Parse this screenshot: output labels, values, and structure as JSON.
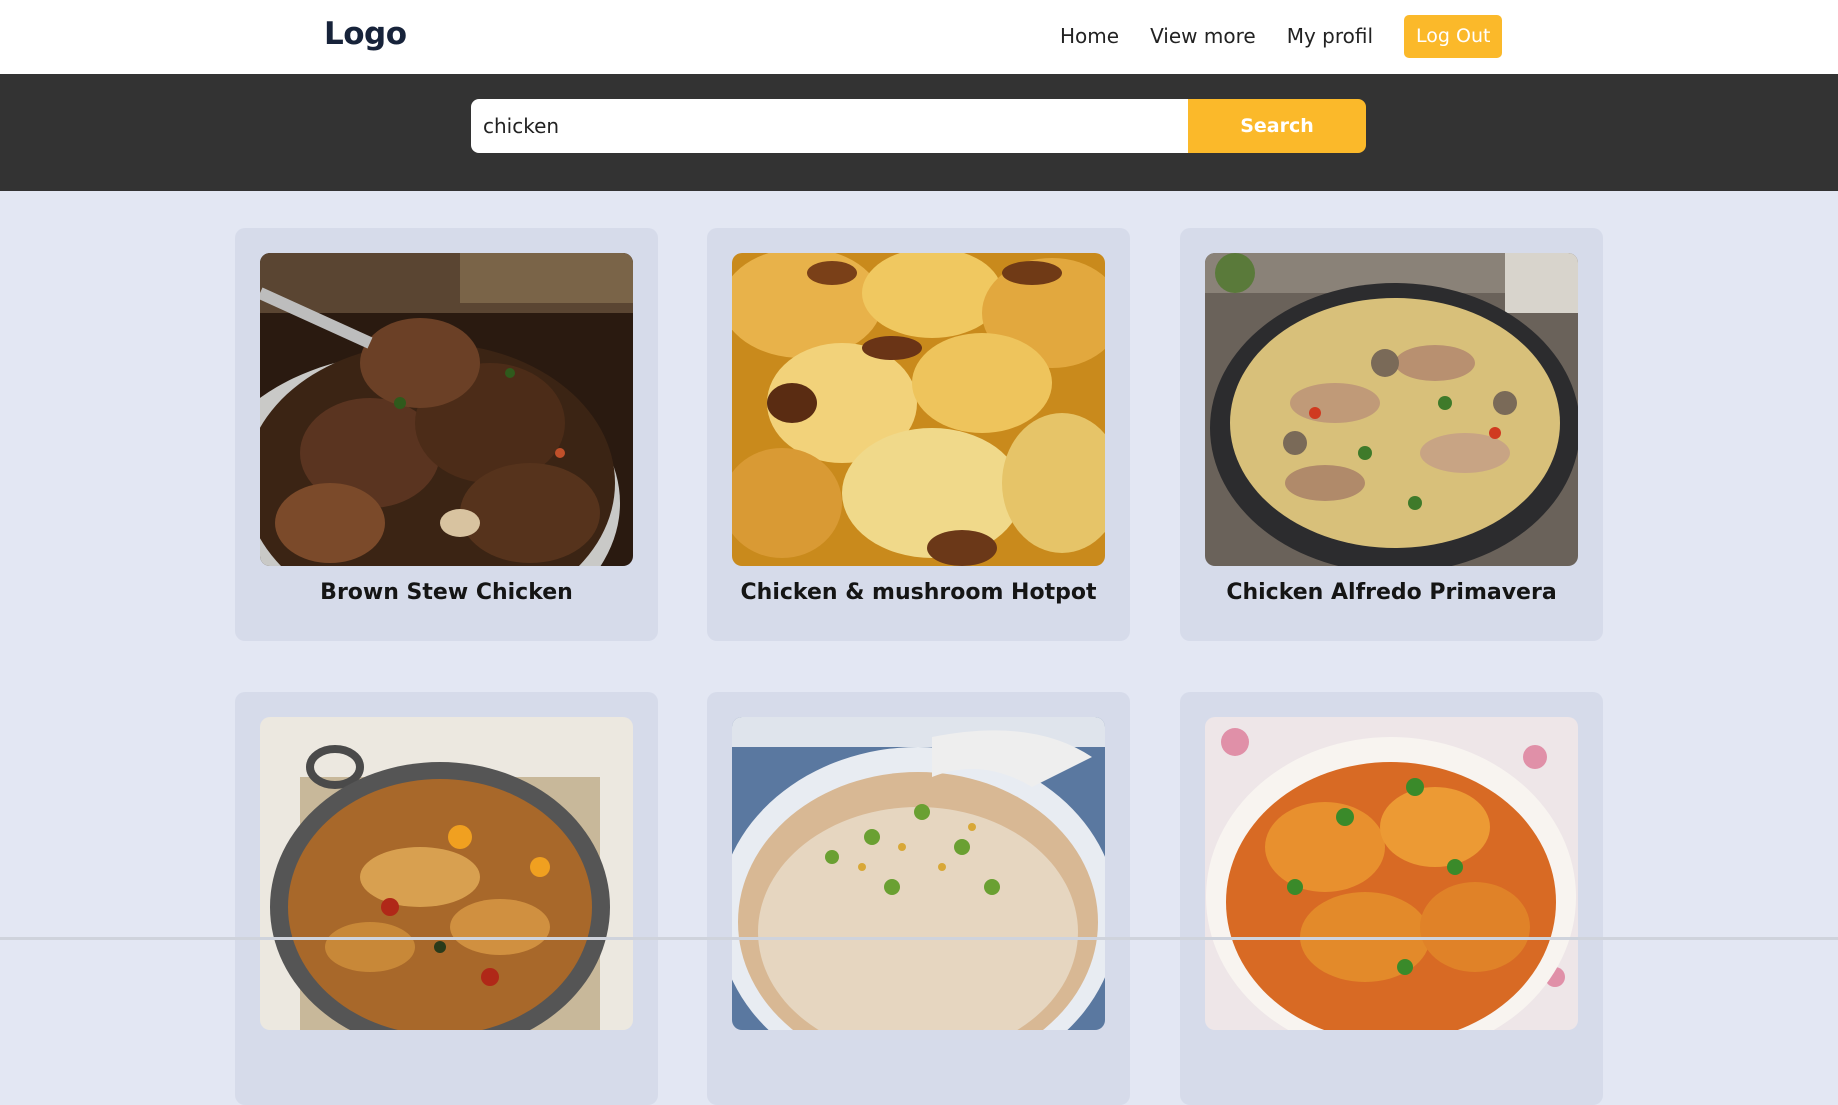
{
  "header": {
    "logo": "Logo",
    "nav": [
      "Home",
      "View more",
      "My profil"
    ],
    "logout_label": "Log Out"
  },
  "search": {
    "value": "chicken",
    "button_label": "Search"
  },
  "recipes": [
    {
      "title": "Brown Stew Chicken",
      "image": "brown-stew-chicken-photo"
    },
    {
      "title": "Chicken & mushroom Hotpot",
      "image": "chicken-mushroom-hotpot-photo"
    },
    {
      "title": "Chicken Alfredo Primavera",
      "image": "chicken-alfredo-primavera-photo"
    },
    {
      "title": "",
      "image": "chicken-casserole-photo"
    },
    {
      "title": "",
      "image": "chicken-congee-photo"
    },
    {
      "title": "",
      "image": "chicken-curry-photo"
    }
  ],
  "colors": {
    "accent": "#fbb92a",
    "header_band": "#333333",
    "page_background": "#e3e7f3",
    "card_background": "#d6dbea"
  }
}
